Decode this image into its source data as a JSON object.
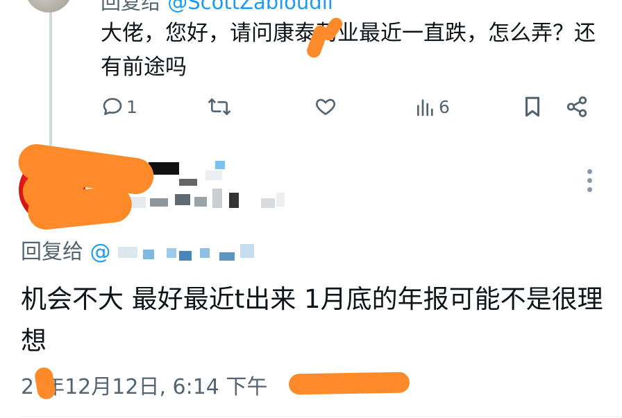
{
  "parent_tweet": {
    "reply_prefix": "回复给",
    "reply_handle": "@ScottZabloudil",
    "text": "大佬，您好，请问康泰药业最近一直跌，怎么弄？还有前途吗",
    "actions": {
      "reply_count": "1",
      "retweet_count": "",
      "like_count": "",
      "views_count": "6"
    }
  },
  "reply_tweet": {
    "display_name": "",
    "handle": "",
    "reply_prefix": "回复给",
    "reply_handle": "@",
    "text": "机会不大 最好最近t出来 1月底的年报可能不是很理想",
    "timestamp": "2",
    "timestamp_rest": "年12月12日, 6:14 下午"
  },
  "colors": {
    "accent": "#1d9bf0",
    "secondary_text": "#536471",
    "primary_text": "#0f1419",
    "redaction": "#ff8a2a",
    "avatar_red": "#e01818"
  },
  "icons": {
    "reply": "reply-icon",
    "retweet": "retweet-icon",
    "like": "heart-icon",
    "views": "views-icon",
    "bookmark": "bookmark-icon",
    "share": "share-icon",
    "more": "more-vertical-icon"
  }
}
